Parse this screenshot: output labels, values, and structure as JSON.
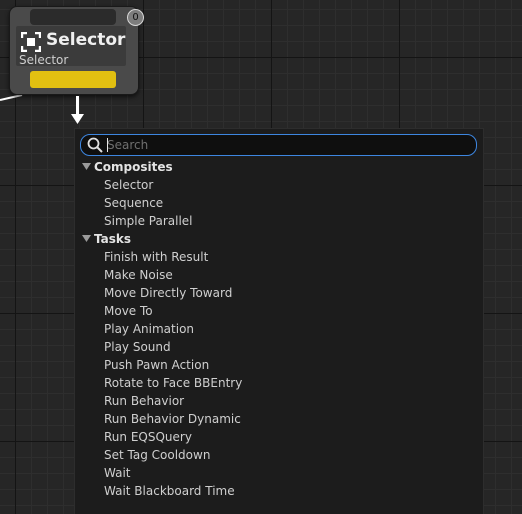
{
  "node": {
    "title": "Selector",
    "subtitle": "Selector",
    "index_badge": "0",
    "icon": "selector-icon",
    "pin_color": "#e2c011"
  },
  "search": {
    "placeholder": "Search",
    "value": "",
    "accent": "#3d86e0"
  },
  "categories": [
    {
      "label": "Composites",
      "items": [
        "Selector",
        "Sequence",
        "Simple Parallel"
      ]
    },
    {
      "label": "Tasks",
      "items": [
        "Finish with Result",
        "Make Noise",
        "Move Directly Toward",
        "Move To",
        "Play Animation",
        "Play Sound",
        "Push Pawn Action",
        "Rotate to Face BBEntry",
        "Run Behavior",
        "Run Behavior Dynamic",
        "Run EQSQuery",
        "Set Tag Cooldown",
        "Wait",
        "Wait Blackboard Time"
      ]
    }
  ]
}
